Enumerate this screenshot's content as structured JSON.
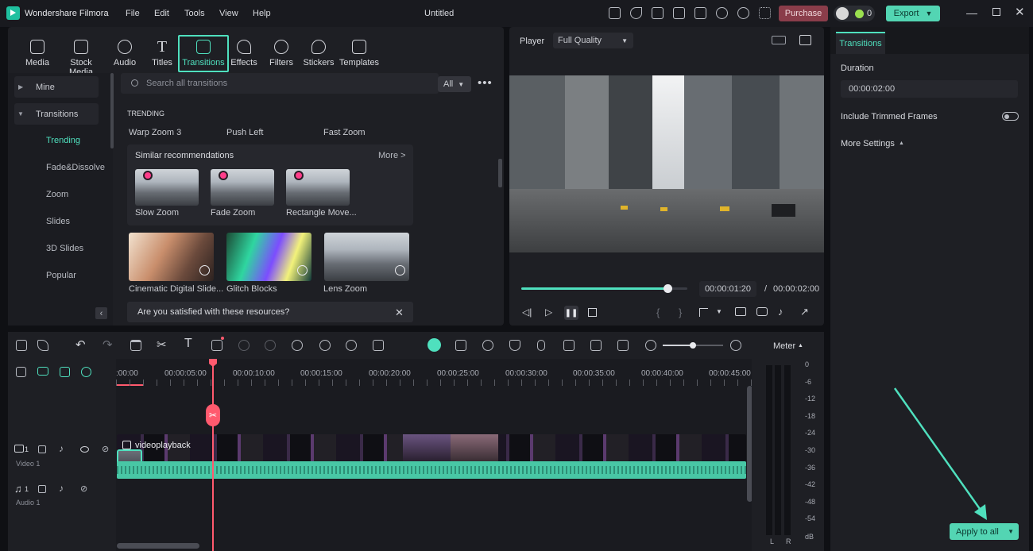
{
  "app": {
    "name": "Wondershare Filmora",
    "project_title": "Untitled",
    "purchase_label": "Purchase",
    "export_label": "Export",
    "points": "0"
  },
  "menu": [
    "File",
    "Edit",
    "Tools",
    "View",
    "Help"
  ],
  "tools": [
    "Media",
    "Stock Media",
    "Audio",
    "Titles",
    "Transitions",
    "Effects",
    "Filters",
    "Stickers",
    "Templates"
  ],
  "sidebar": {
    "mine": "Mine",
    "transitions": "Transitions",
    "subs": [
      "Trending",
      "Fade&Dissolve",
      "Zoom",
      "Slides",
      "3D Slides",
      "Popular"
    ]
  },
  "search": {
    "placeholder": "Search all transitions",
    "filter": "All"
  },
  "trending": {
    "heading": "TRENDING",
    "items": [
      "Warp Zoom 3",
      "Push Left",
      "Fast Zoom"
    ]
  },
  "similar": {
    "title": "Similar recommendations",
    "more": "More >",
    "items": [
      "Slow Zoom",
      "Fade Zoom",
      "Rectangle Move..."
    ]
  },
  "cards": [
    "Cinematic Digital Slide...",
    "Glitch Blocks",
    "Lens Zoom"
  ],
  "feedback": "Are you satisfied with these resources?",
  "player": {
    "label": "Player",
    "quality": "Full Quality",
    "current": "00:00:01:20",
    "sep": "/",
    "total": "00:00:02:00",
    "progress": 0.88
  },
  "right": {
    "tab": "Transitions",
    "duration_label": "Duration",
    "duration_value": "00:00:02:00",
    "trimmed_label": "Include Trimmed Frames",
    "more_settings": "More Settings",
    "apply_label": "Apply to all"
  },
  "timeline": {
    "ruler": [
      ":00:00",
      "00:00:05:00",
      "00:00:10:00",
      "00:00:15:00",
      "00:00:20:00",
      "00:00:25:00",
      "00:00:30:00",
      "00:00:35:00",
      "00:00:40:00",
      "00:00:45:00"
    ],
    "video_track": {
      "num": "1",
      "label": "Video 1"
    },
    "audio_track": {
      "num": "1",
      "label": "Audio 1"
    },
    "clip_name": "videoplayback"
  },
  "meter": {
    "label": "Meter",
    "scale": [
      "0",
      "-6",
      "-12",
      "-18",
      "-24",
      "-30",
      "-36",
      "-42",
      "-48",
      "-54",
      "dB"
    ],
    "left": "L",
    "right": "R"
  },
  "colors": {
    "accent": "#4fe0be",
    "playhead": "#ff5a6e",
    "purchase": "#8a3d4a"
  }
}
